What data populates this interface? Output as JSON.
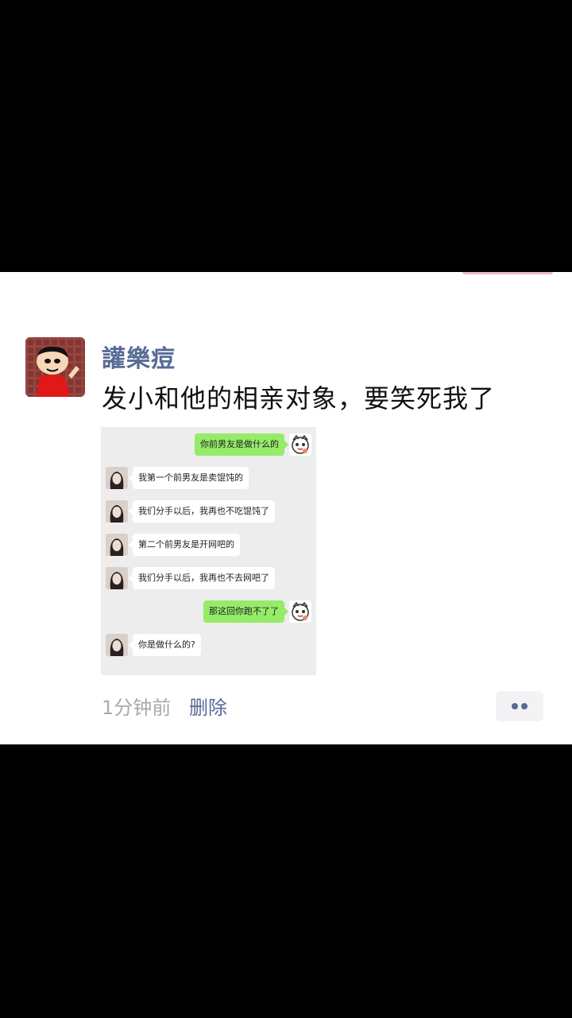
{
  "post": {
    "username": "讙樂痘",
    "text": "发小和他的相亲对象，要笑死我了",
    "time": "1分钟前",
    "delete_label": "删除"
  },
  "chat": {
    "messages": [
      {
        "side": "right",
        "text": "你前男友是做什么的"
      },
      {
        "side": "left",
        "text": "我第一个前男友是卖馄饨的"
      },
      {
        "side": "left",
        "text": "我们分手以后，我再也不吃馄饨了"
      },
      {
        "side": "left",
        "text": "第二个前男友是开网吧的"
      },
      {
        "side": "left",
        "text": "我们分手以后，我再也不去网吧了"
      },
      {
        "side": "right",
        "text": "那这回你跑不了了"
      },
      {
        "side": "left",
        "text": "你是做什么的?"
      }
    ]
  },
  "colors": {
    "name_link": "#576b95",
    "sent_bubble": "#95ec69",
    "chat_bg": "#ededed"
  }
}
